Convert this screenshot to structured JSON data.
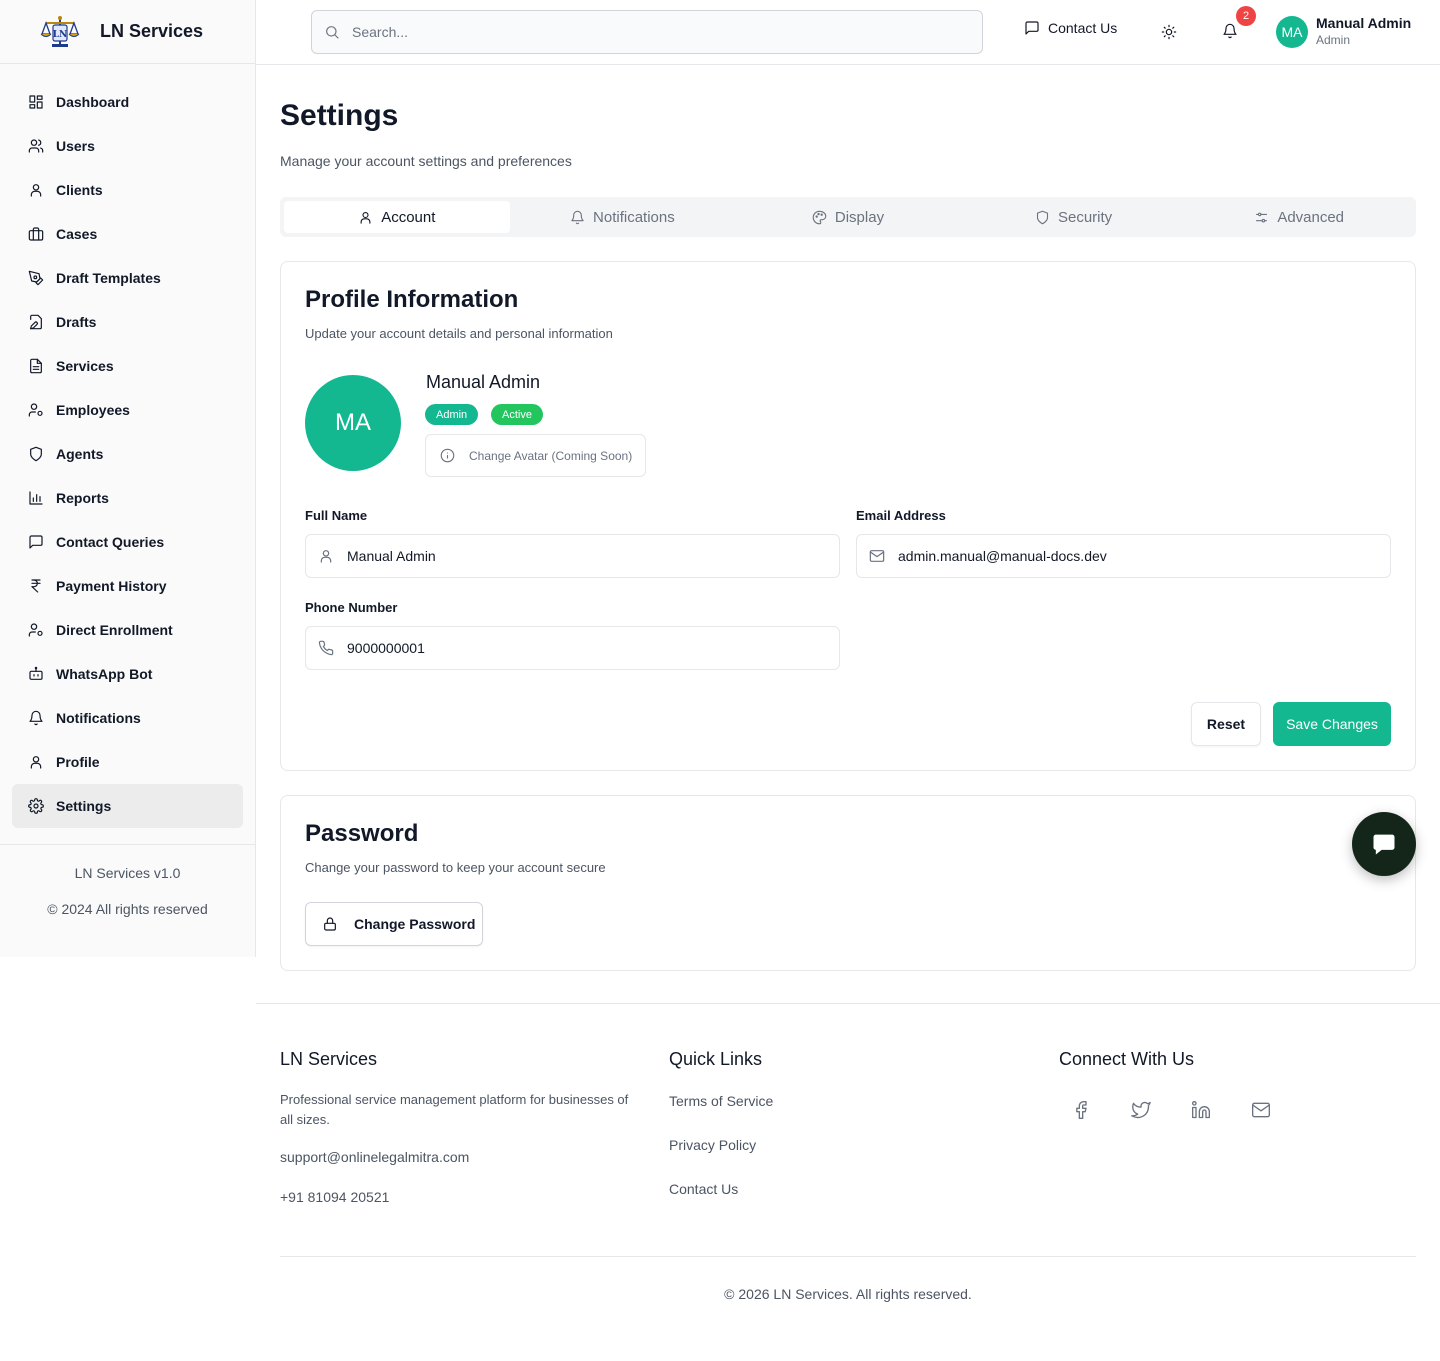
{
  "brand": {
    "name": "LN Services"
  },
  "header": {
    "search_placeholder": "Search...",
    "contact_label": "Contact Us",
    "notification_count": "2",
    "user_initials": "MA",
    "user_name": "Manual Admin",
    "user_role": "Admin"
  },
  "sidebar": {
    "items": [
      {
        "label": "Dashboard",
        "icon": "dashboard-icon"
      },
      {
        "label": "Users",
        "icon": "users-icon"
      },
      {
        "label": "Clients",
        "icon": "user-icon"
      },
      {
        "label": "Cases",
        "icon": "briefcase-icon"
      },
      {
        "label": "Draft Templates",
        "icon": "pen-tool-icon"
      },
      {
        "label": "Drafts",
        "icon": "edit-file-icon"
      },
      {
        "label": "Services",
        "icon": "file-text-icon"
      },
      {
        "label": "Employees",
        "icon": "user-cog-icon"
      },
      {
        "label": "Agents",
        "icon": "shield-icon"
      },
      {
        "label": "Reports",
        "icon": "bar-chart-icon"
      },
      {
        "label": "Contact Queries",
        "icon": "message-icon"
      },
      {
        "label": "Payment History",
        "icon": "rupee-icon"
      },
      {
        "label": "Direct Enrollment",
        "icon": "user-cog-icon"
      },
      {
        "label": "WhatsApp Bot",
        "icon": "bot-icon"
      },
      {
        "label": "Notifications",
        "icon": "bell-icon"
      },
      {
        "label": "Profile",
        "icon": "user-icon"
      },
      {
        "label": "Settings",
        "icon": "settings-icon"
      }
    ],
    "active": "Settings",
    "version": "LN Services v1.0",
    "copyright": "© 2024 All rights reserved"
  },
  "page": {
    "title": "Settings",
    "subtitle": "Manage your account settings and preferences"
  },
  "tabs": [
    {
      "label": "Account",
      "icon": "user-icon"
    },
    {
      "label": "Notifications",
      "icon": "bell-icon"
    },
    {
      "label": "Display",
      "icon": "palette-icon"
    },
    {
      "label": "Security",
      "icon": "shield-icon"
    },
    {
      "label": "Advanced",
      "icon": "sliders-icon"
    }
  ],
  "active_tab": "Account",
  "profile": {
    "title": "Profile Information",
    "subtitle": "Update your account details and personal information",
    "initials": "MA",
    "name": "Manual Admin",
    "role_badge": "Admin",
    "status_badge": "Active",
    "change_avatar_label": "Change Avatar (Coming Soon)",
    "full_name_label": "Full Name",
    "full_name_value": "Manual Admin",
    "email_label": "Email Address",
    "email_value": "admin.manual@manual-docs.dev",
    "phone_label": "Phone Number",
    "phone_value": "9000000001",
    "reset_label": "Reset",
    "save_label": "Save Changes"
  },
  "password": {
    "title": "Password",
    "subtitle": "Change your password to keep your account secure",
    "button_label": "Change Password"
  },
  "footer": {
    "brand_title": "LN Services",
    "description": "Professional service management platform for businesses of all sizes.",
    "email": "support@onlinelegalmitra.com",
    "phone": "+91 81094 20521",
    "quick_links_title": "Quick Links",
    "links": [
      "Terms of Service",
      "Privacy Policy",
      "Contact Us"
    ],
    "connect_title": "Connect With Us",
    "social": [
      "facebook-icon",
      "twitter-icon",
      "linkedin-icon",
      "mail-icon"
    ],
    "copyright": "© 2026 LN Services. All rights reserved."
  },
  "colors": {
    "accent": "#14b890",
    "active_badge": "#22c55e",
    "notification_badge": "#ef4444",
    "chat_fab": "#14261a"
  }
}
